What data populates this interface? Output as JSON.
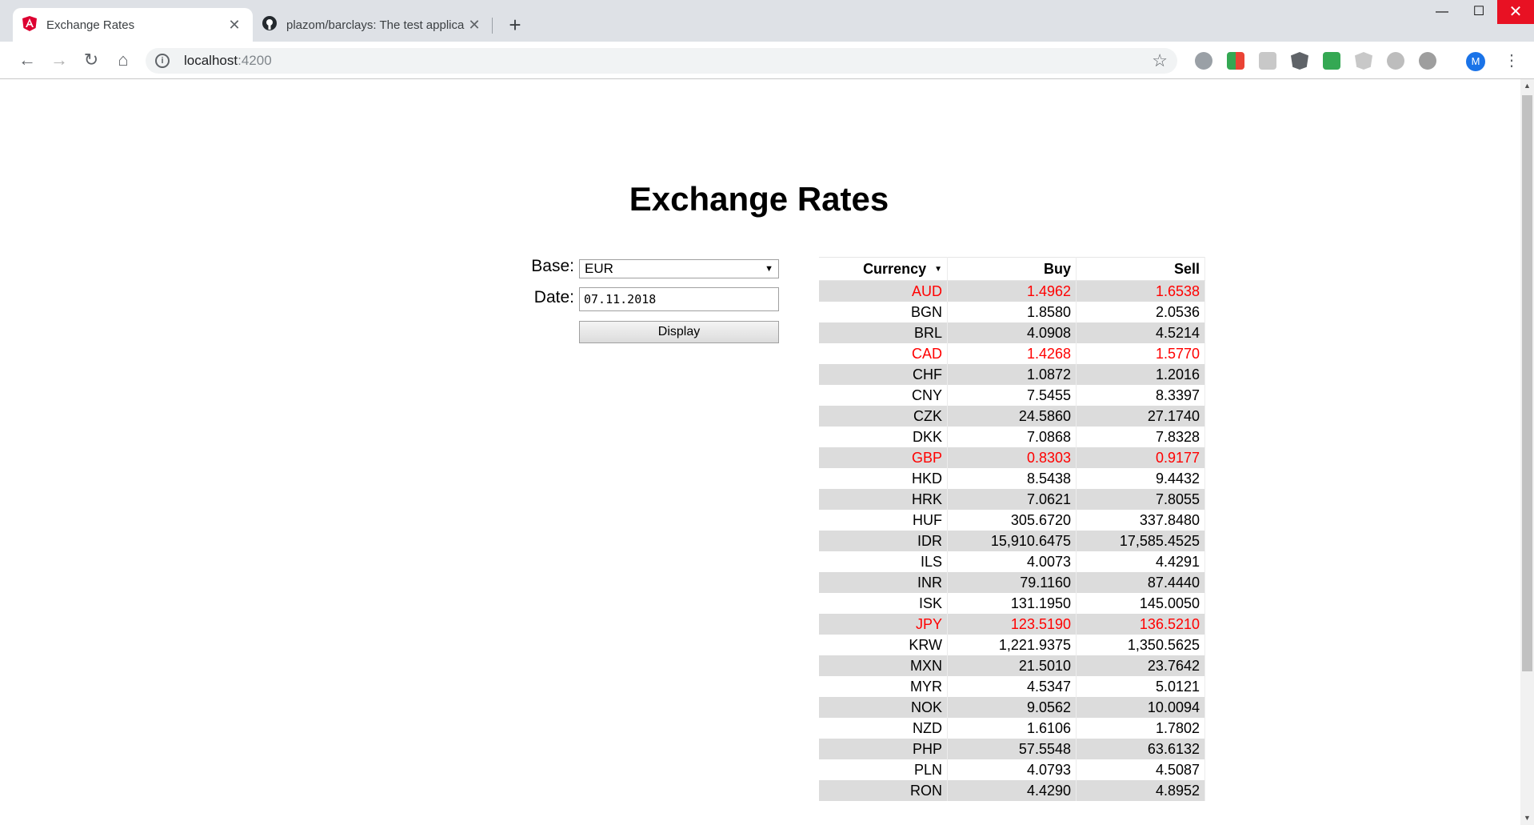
{
  "browser": {
    "tabs": [
      {
        "title": "Exchange Rates",
        "active": true
      },
      {
        "title": "plazom/barclays: The test applica",
        "active": false
      }
    ],
    "url_host": "localhost",
    "url_port": ":4200",
    "profile_initial": "M"
  },
  "page": {
    "title": "Exchange Rates",
    "base_label": "Base:",
    "base_value": "EUR",
    "date_label": "Date:",
    "date_value": "07.11.2018",
    "display_button": "Display"
  },
  "table": {
    "headers": [
      "Currency",
      "Buy",
      "Sell"
    ],
    "rows": [
      {
        "currency": "AUD",
        "buy": "1.4962",
        "sell": "1.6538",
        "highlight": true
      },
      {
        "currency": "BGN",
        "buy": "1.8580",
        "sell": "2.0536",
        "highlight": false
      },
      {
        "currency": "BRL",
        "buy": "4.0908",
        "sell": "4.5214",
        "highlight": false
      },
      {
        "currency": "CAD",
        "buy": "1.4268",
        "sell": "1.5770",
        "highlight": true
      },
      {
        "currency": "CHF",
        "buy": "1.0872",
        "sell": "1.2016",
        "highlight": false
      },
      {
        "currency": "CNY",
        "buy": "7.5455",
        "sell": "8.3397",
        "highlight": false
      },
      {
        "currency": "CZK",
        "buy": "24.5860",
        "sell": "27.1740",
        "highlight": false
      },
      {
        "currency": "DKK",
        "buy": "7.0868",
        "sell": "7.8328",
        "highlight": false
      },
      {
        "currency": "GBP",
        "buy": "0.8303",
        "sell": "0.9177",
        "highlight": true
      },
      {
        "currency": "HKD",
        "buy": "8.5438",
        "sell": "9.4432",
        "highlight": false
      },
      {
        "currency": "HRK",
        "buy": "7.0621",
        "sell": "7.8055",
        "highlight": false
      },
      {
        "currency": "HUF",
        "buy": "305.6720",
        "sell": "337.8480",
        "highlight": false
      },
      {
        "currency": "IDR",
        "buy": "15,910.6475",
        "sell": "17,585.4525",
        "highlight": false
      },
      {
        "currency": "ILS",
        "buy": "4.0073",
        "sell": "4.4291",
        "highlight": false
      },
      {
        "currency": "INR",
        "buy": "79.1160",
        "sell": "87.4440",
        "highlight": false
      },
      {
        "currency": "ISK",
        "buy": "131.1950",
        "sell": "145.0050",
        "highlight": false
      },
      {
        "currency": "JPY",
        "buy": "123.5190",
        "sell": "136.5210",
        "highlight": true
      },
      {
        "currency": "KRW",
        "buy": "1,221.9375",
        "sell": "1,350.5625",
        "highlight": false
      },
      {
        "currency": "MXN",
        "buy": "21.5010",
        "sell": "23.7642",
        "highlight": false
      },
      {
        "currency": "MYR",
        "buy": "4.5347",
        "sell": "5.0121",
        "highlight": false
      },
      {
        "currency": "NOK",
        "buy": "9.0562",
        "sell": "10.0094",
        "highlight": false
      },
      {
        "currency": "NZD",
        "buy": "1.6106",
        "sell": "1.7802",
        "highlight": false
      },
      {
        "currency": "PHP",
        "buy": "57.5548",
        "sell": "63.6132",
        "highlight": false
      },
      {
        "currency": "PLN",
        "buy": "4.0793",
        "sell": "4.5087",
        "highlight": false
      },
      {
        "currency": "RON",
        "buy": "4.4290",
        "sell": "4.8952",
        "highlight": false
      }
    ]
  },
  "colors": {
    "highlight": "#ff0000",
    "row_stripe": "#dcdcdc",
    "tab_strip": "#dee1e6",
    "angular_red": "#dd0031"
  },
  "icons": [
    "angular-icon",
    "github-icon",
    "back-icon",
    "forward-icon",
    "reload-icon",
    "home-icon",
    "info-icon",
    "star-icon",
    "adblock-icon",
    "menu-icon"
  ]
}
